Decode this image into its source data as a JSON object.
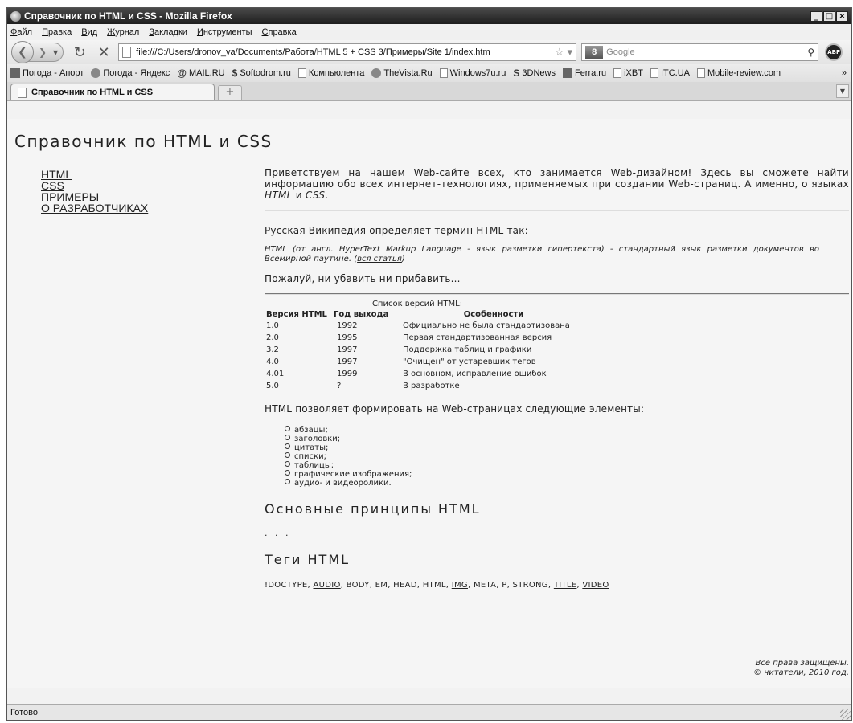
{
  "window": {
    "title": "Справочник по HTML и CSS - Mozilla Firefox",
    "buttons": {
      "minimize": "_",
      "maximize": "□",
      "close": "×"
    }
  },
  "menubar": [
    "Файл",
    "Правка",
    "Вид",
    "Журнал",
    "Закладки",
    "Инструменты",
    "Справка"
  ],
  "navbar": {
    "url": "file:///C:/Users/dronov_va/Documents/Работа/HTML 5 + CSS 3/Примеры/Site 1/index.htm",
    "search_placeholder": "Google",
    "search_engine_logo": "8",
    "addon_label": "ABP"
  },
  "bookmarks": [
    "Погода - Апорт",
    "Погода - Яндекс",
    "MAIL.RU",
    "Softodrom.ru",
    "Компьюлента",
    "TheVista.Ru",
    "Windows7u.ru",
    "3DNews",
    "Ferra.ru",
    "iXBT",
    "ITC.UA",
    "Mobile-review.com"
  ],
  "bookmarks_more": "»",
  "tabs": [
    {
      "label": "Справочник по HTML и CSS",
      "active": true
    }
  ],
  "new_tab_label": "+",
  "page": {
    "title": "Справочник по HTML и CSS",
    "nav": [
      "HTML",
      "CSS",
      "ПРИМЕРЫ",
      "О РАЗРАБОТЧИКАХ"
    ],
    "intro": {
      "before": "Приветствуем на нашем Web-сайте всех, кто занимается Web-дизайном! Здесь вы сможете найти информацию обо всех интернет-технологиях, применяемых при создании Web-страниц. А именно, о языках ",
      "html": "HTML",
      "mid": " и ",
      "css": "CSS",
      "after": "."
    },
    "wiki_intro": "Русская Википедия определяет термин HTML так:",
    "quote_text": "HTML (от англ. HyperText Markup Language - язык разметки гипертекста) - стандартный язык разметки документов во Всемирной паутине. (",
    "quote_link": "вся статья",
    "quote_end": ")",
    "comment": "Пожалуй, ни убавить ни прибавить...",
    "table": {
      "caption": "Список версий HTML:",
      "headers": [
        "Версия HTML",
        "Год выхода",
        "Особенности"
      ],
      "rows": [
        [
          "1.0",
          "1992",
          "Официально не была стандартизована"
        ],
        [
          "2.0",
          "1995",
          "Первая стандартизованная версия"
        ],
        [
          "3.2",
          "1997",
          "Поддержка таблиц и графики"
        ],
        [
          "4.0",
          "1997",
          "\"Очищен\" от устаревших тегов"
        ],
        [
          "4.01",
          "1999",
          "В основном, исправление ошибок"
        ],
        [
          "5.0",
          "?",
          "В разработке"
        ]
      ]
    },
    "elements_intro": "HTML позволяет формировать на Web-страницах следующие элементы:",
    "elements": [
      "абзацы;",
      "заголовки;",
      "цитаты;",
      "списки;",
      "таблицы;",
      "графические изображения;",
      "аудио- и видеоролики."
    ],
    "principles_heading": "Основные принципы HTML",
    "ellipsis": ". . .",
    "tags_heading": "Теги HTML",
    "tags": [
      {
        "text": "!DOCTYPE",
        "link": false
      },
      {
        "text": "AUDIO",
        "link": true
      },
      {
        "text": "BODY",
        "link": false
      },
      {
        "text": "EM",
        "link": false
      },
      {
        "text": "HEAD",
        "link": false
      },
      {
        "text": "HTML",
        "link": false
      },
      {
        "text": "IMG",
        "link": true
      },
      {
        "text": "META",
        "link": false
      },
      {
        "text": "P",
        "link": false
      },
      {
        "text": "STRONG",
        "link": false
      },
      {
        "text": "TITLE",
        "link": true
      },
      {
        "text": "VIDEO",
        "link": true
      }
    ],
    "footer": {
      "line1": "Все права защищены.",
      "copyright": "©",
      "link": "читатели",
      "rest": ", 2010 год."
    }
  },
  "status": "Готово"
}
